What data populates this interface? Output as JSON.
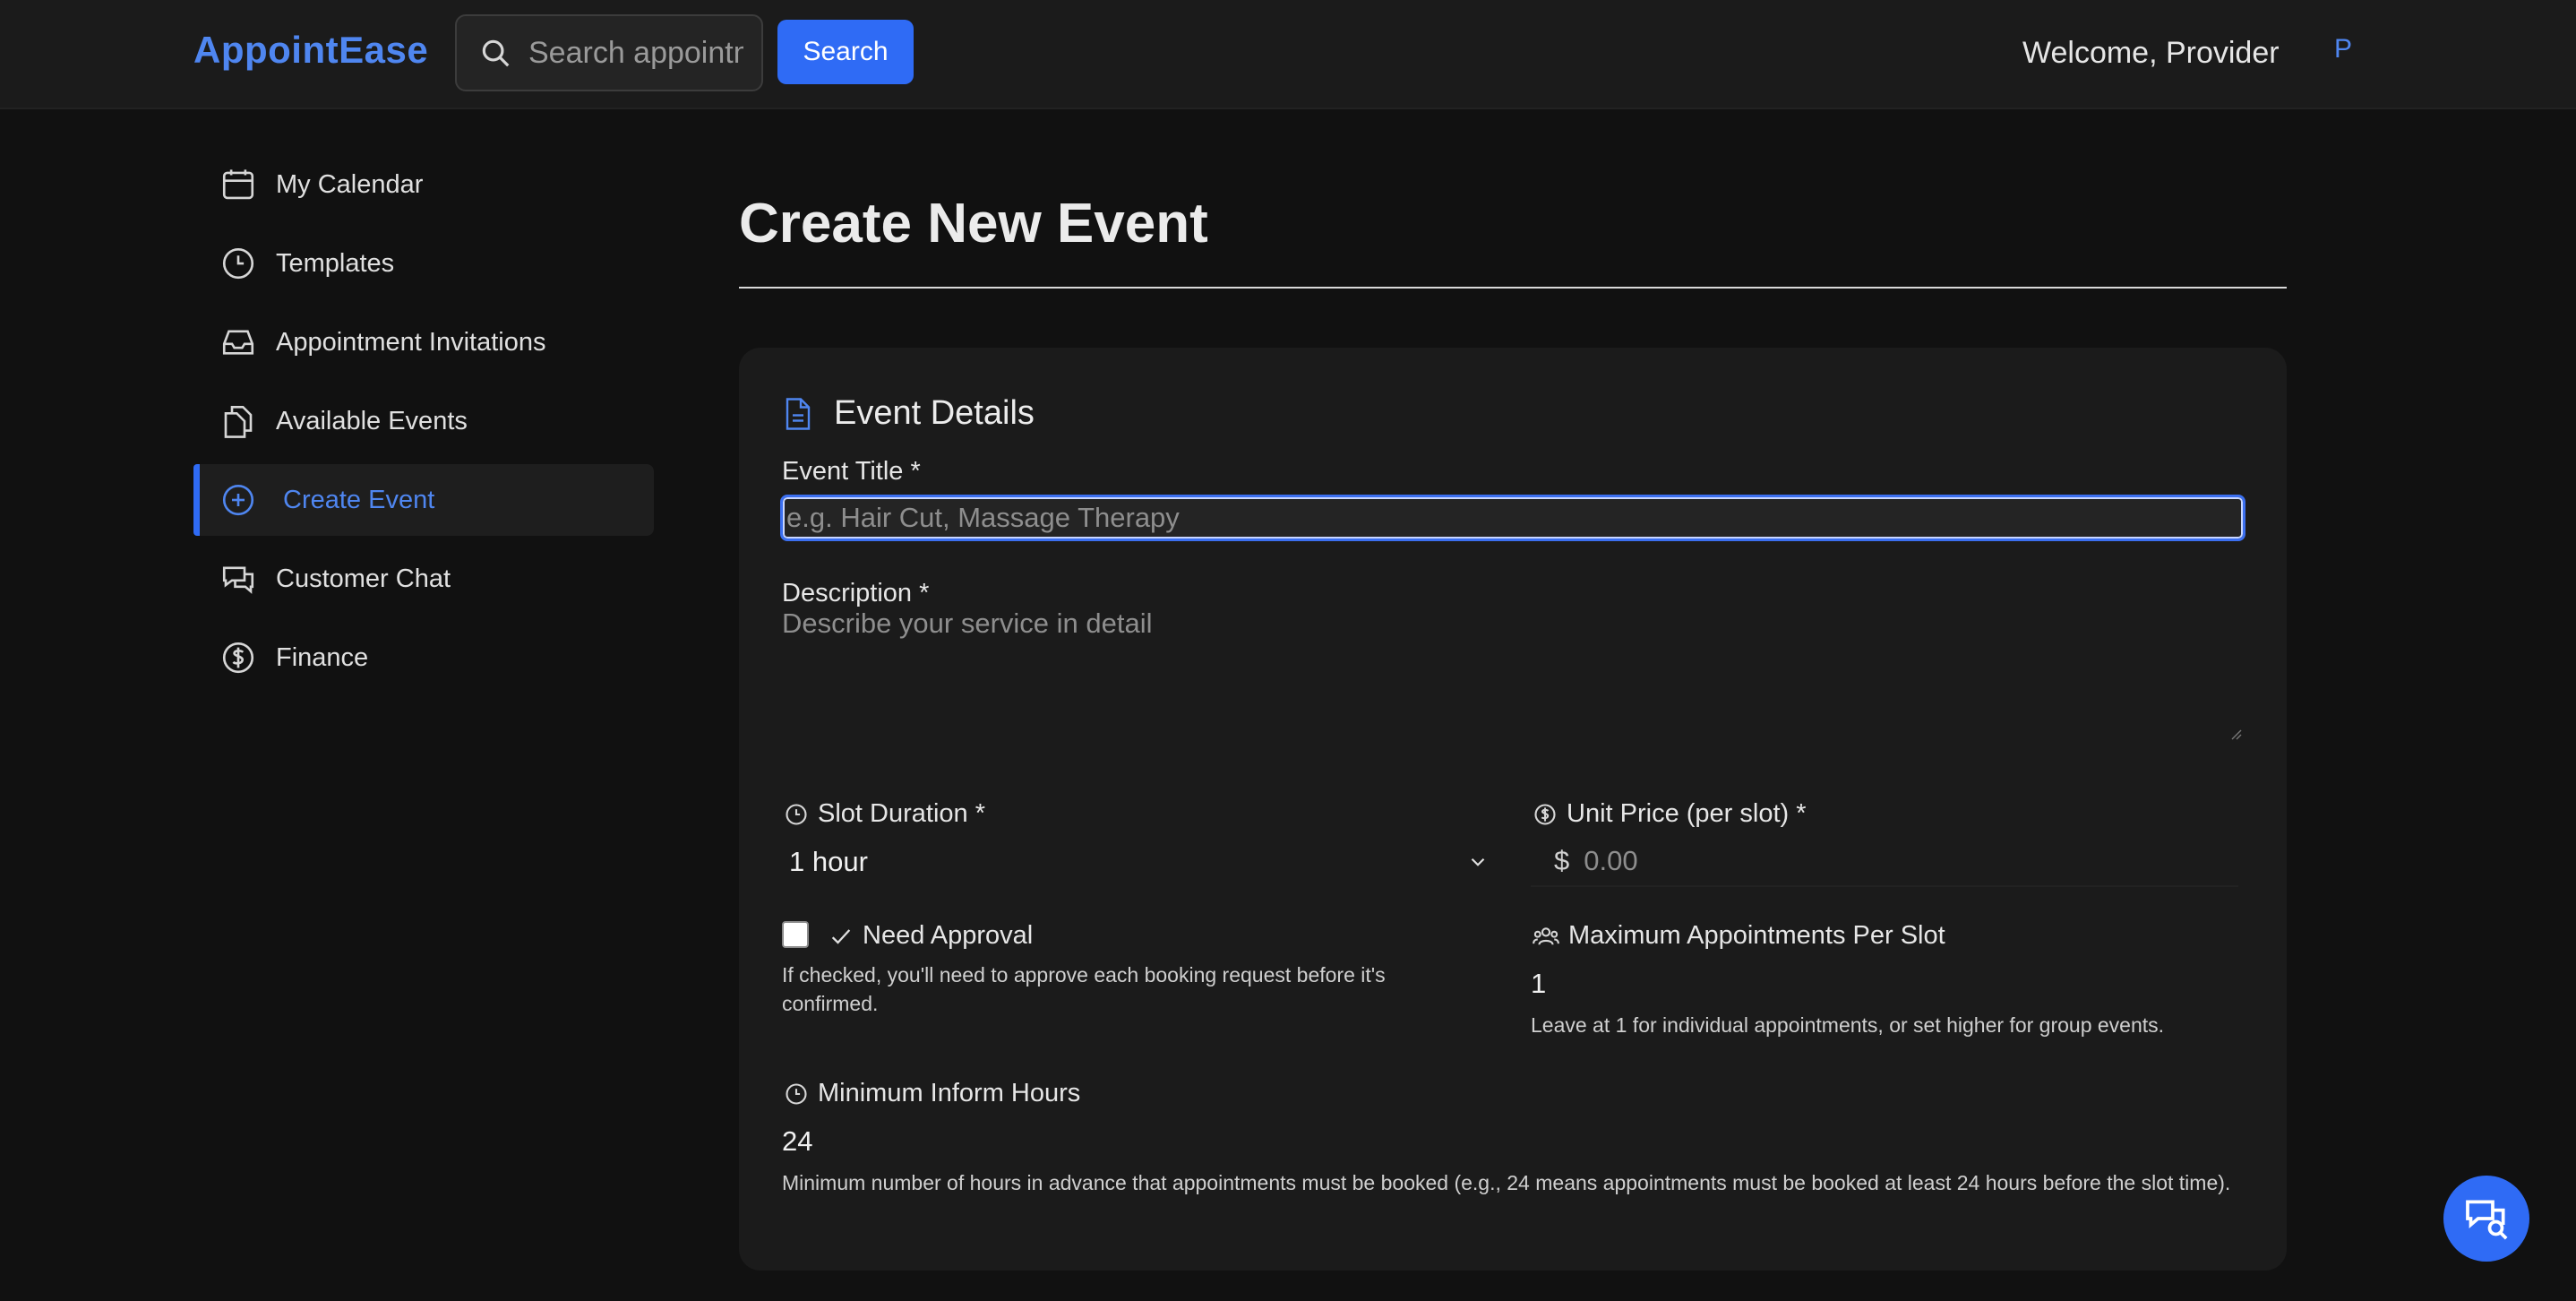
{
  "header": {
    "brand": "AppointEase",
    "search_placeholder": "Search appointments",
    "search_button": "Search",
    "welcome": "Welcome, Provider",
    "avatar_initial": "P"
  },
  "sidebar": {
    "items": [
      {
        "label": "My Calendar",
        "icon": "calendar-icon",
        "active": false
      },
      {
        "label": "Templates",
        "icon": "clock-icon",
        "active": false
      },
      {
        "label": "Appointment Invitations",
        "icon": "inbox-icon",
        "active": false
      },
      {
        "label": "Available Events",
        "icon": "documents-icon",
        "active": false
      },
      {
        "label": "Create Event",
        "icon": "plus-circle-icon",
        "active": true
      },
      {
        "label": "Customer Chat",
        "icon": "chat-icon",
        "active": false
      },
      {
        "label": "Finance",
        "icon": "dollar-circle-icon",
        "active": false
      }
    ]
  },
  "main": {
    "title": "Create New Event",
    "section_title": "Event Details",
    "event_title_label": "Event Title *",
    "event_title_placeholder": "e.g. Hair Cut, Massage Therapy",
    "description_label": "Description *",
    "description_placeholder": "Describe your service in detail",
    "slot_duration_label": "Slot Duration *",
    "slot_duration_value": "1 hour",
    "unit_price_label": "Unit Price (per slot) *",
    "currency_symbol": "$",
    "unit_price_placeholder": "0.00",
    "need_approval_label": "Need Approval",
    "need_approval_checked": false,
    "need_approval_help": "If checked, you'll need to approve each booking request before it's confirmed.",
    "max_appointments_label": "Maximum Appointments Per Slot",
    "max_appointments_value": "1",
    "max_appointments_help": "Leave at 1 for individual appointments, or set higher for group events.",
    "min_inform_label": "Minimum Inform Hours",
    "min_inform_value": "24",
    "min_inform_help": "Minimum number of hours in advance that appointments must be booked (e.g., 24 means appointments must be booked at least 24 hours before the slot time)."
  },
  "colors": {
    "accent": "#2f6bf5",
    "brand": "#4f86f0",
    "background": "#111111",
    "card": "#1b1b1b"
  }
}
